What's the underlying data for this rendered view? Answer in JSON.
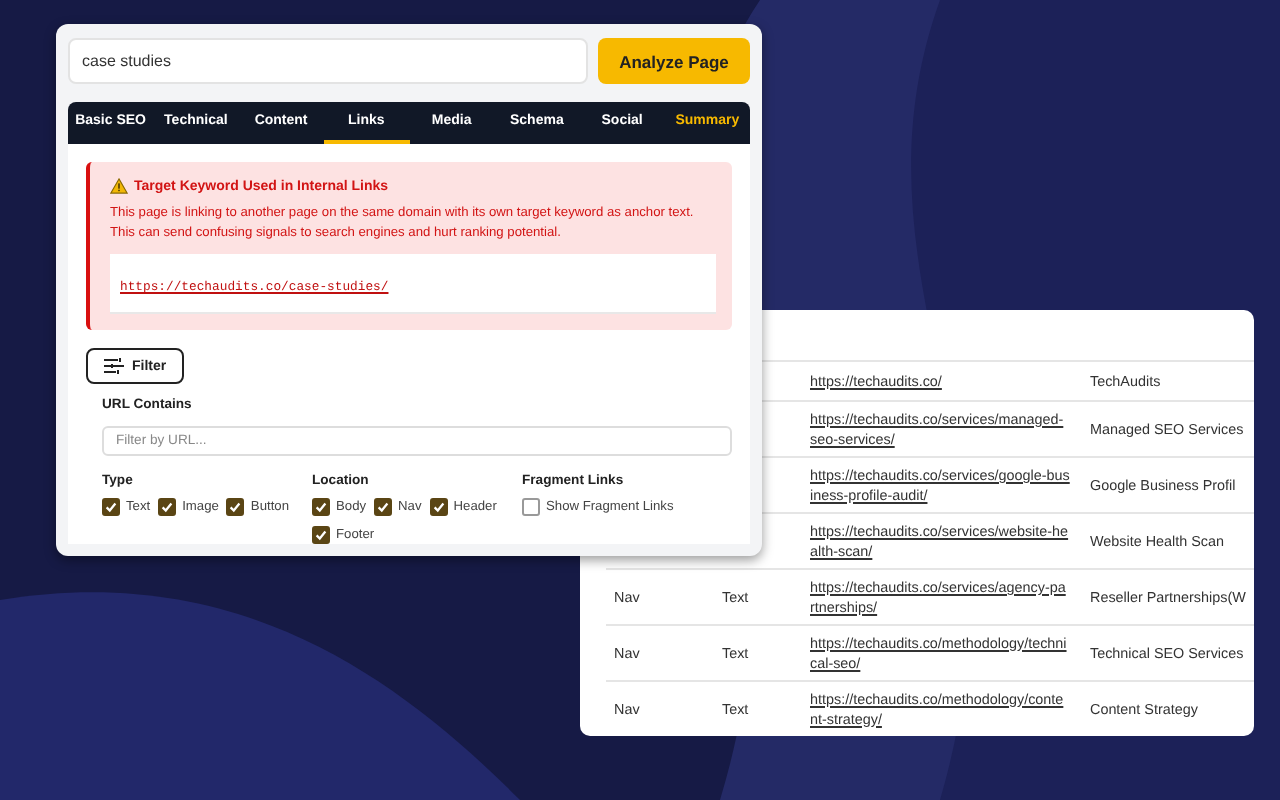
{
  "search": {
    "value": "case studies"
  },
  "analyze_button": {
    "label": "Analyze Page"
  },
  "tabs": [
    {
      "label": "Basic SEO",
      "selected": false,
      "highlight": false
    },
    {
      "label": "Technical",
      "selected": false,
      "highlight": false
    },
    {
      "label": "Content",
      "selected": false,
      "highlight": false
    },
    {
      "label": "Links",
      "selected": true,
      "highlight": false
    },
    {
      "label": "Media",
      "selected": false,
      "highlight": false
    },
    {
      "label": "Schema",
      "selected": false,
      "highlight": false
    },
    {
      "label": "Social",
      "selected": false,
      "highlight": false
    },
    {
      "label": "Summary",
      "selected": false,
      "highlight": true
    }
  ],
  "alert": {
    "title": "Target Keyword Used in Internal Links",
    "message": "This page is linking to another page on the same domain with its own target keyword as anchor text. This can send confusing signals to search engines and hurt ranking potential.",
    "link": "https://techaudits.co/case-studies/"
  },
  "filter_button": {
    "label": "Filter"
  },
  "url_filter": {
    "label": "URL Contains",
    "placeholder": "Filter by URL..."
  },
  "filter_groups": [
    {
      "title": "Type",
      "options": [
        {
          "label": "Text",
          "checked": true
        },
        {
          "label": "Image",
          "checked": true
        },
        {
          "label": "Button",
          "checked": true
        }
      ]
    },
    {
      "title": "Location",
      "options": [
        {
          "label": "Body",
          "checked": true
        },
        {
          "label": "Nav",
          "checked": true
        },
        {
          "label": "Header",
          "checked": true
        },
        {
          "label": "Footer",
          "checked": true
        }
      ]
    },
    {
      "title": "Fragment Links",
      "options": [
        {
          "label": "Show Fragment Links",
          "checked": false
        }
      ]
    }
  ],
  "links_table": {
    "rows": [
      {
        "column_1": "",
        "column_2": "",
        "url": "https://techaudits.co/",
        "anchor": "TechAudits"
      },
      {
        "column_1": "",
        "column_2": "",
        "url": "https://techaudits.co/services/managed-seo-services/",
        "anchor": "Managed SEO Services"
      },
      {
        "column_1": "",
        "column_2": "",
        "url": "https://techaudits.co/services/google-business-profile-audit/",
        "anchor": "Google Business Profil"
      },
      {
        "column_1": "",
        "column_2": "",
        "url": "https://techaudits.co/services/website-health-scan/",
        "anchor": "Website Health Scan"
      },
      {
        "column_1": "Nav",
        "column_2": "Text",
        "url": "https://techaudits.co/services/agency-partnerships/",
        "anchor": "Reseller Partnerships(W"
      },
      {
        "column_1": "Nav",
        "column_2": "Text",
        "url": "https://techaudits.co/methodology/technical-seo/",
        "anchor": "Technical SEO Services"
      },
      {
        "column_1": "Nav",
        "column_2": "Text",
        "url": "https://techaudits.co/methodology/content-strategy/",
        "anchor": "Content Strategy"
      }
    ]
  }
}
